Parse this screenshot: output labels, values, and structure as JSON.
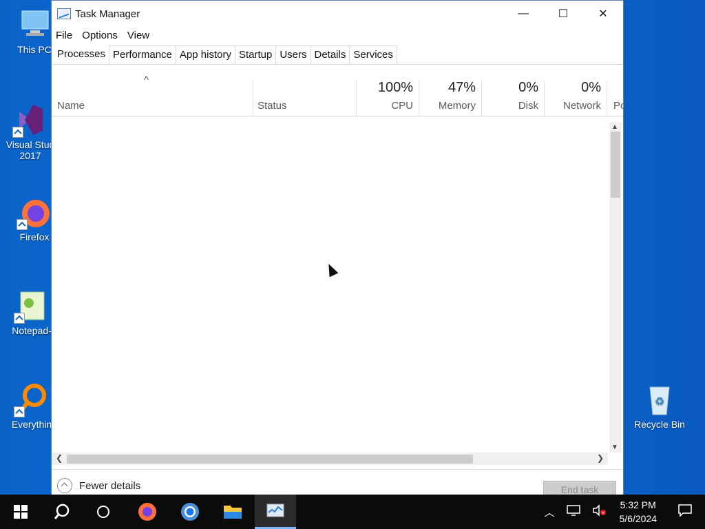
{
  "desktop": {
    "icons": [
      {
        "label": "This PC"
      },
      {
        "label": "Visual Stud\n2017"
      },
      {
        "label": "Firefox"
      },
      {
        "label": "Notepad-"
      },
      {
        "label": "Everythin"
      },
      {
        "label": "Recycle Bin"
      }
    ]
  },
  "window": {
    "title": "Task Manager",
    "controls": {
      "minimize": "—",
      "maximize": "☐",
      "close": "✕"
    },
    "menu": [
      "File",
      "Options",
      "View"
    ],
    "tabs": [
      "Processes",
      "Performance",
      "App history",
      "Startup",
      "Users",
      "Details",
      "Services"
    ],
    "active_tab": "Processes",
    "columns": {
      "name": {
        "label": "Name",
        "sort_indicator": "^"
      },
      "status": {
        "label": "Status"
      },
      "cpu": {
        "label": "CPU",
        "value": "100%"
      },
      "memory": {
        "label": "Memory",
        "value": "47%"
      },
      "disk": {
        "label": "Disk",
        "value": "0%"
      },
      "network": {
        "label": "Network",
        "value": "0%"
      },
      "power": {
        "label": "Po"
      }
    },
    "footer": {
      "fewer_details": "Fewer details",
      "end_task": "End task"
    }
  },
  "taskbar": {
    "clock_time": "5:32 PM",
    "clock_date": "5/6/2024"
  }
}
